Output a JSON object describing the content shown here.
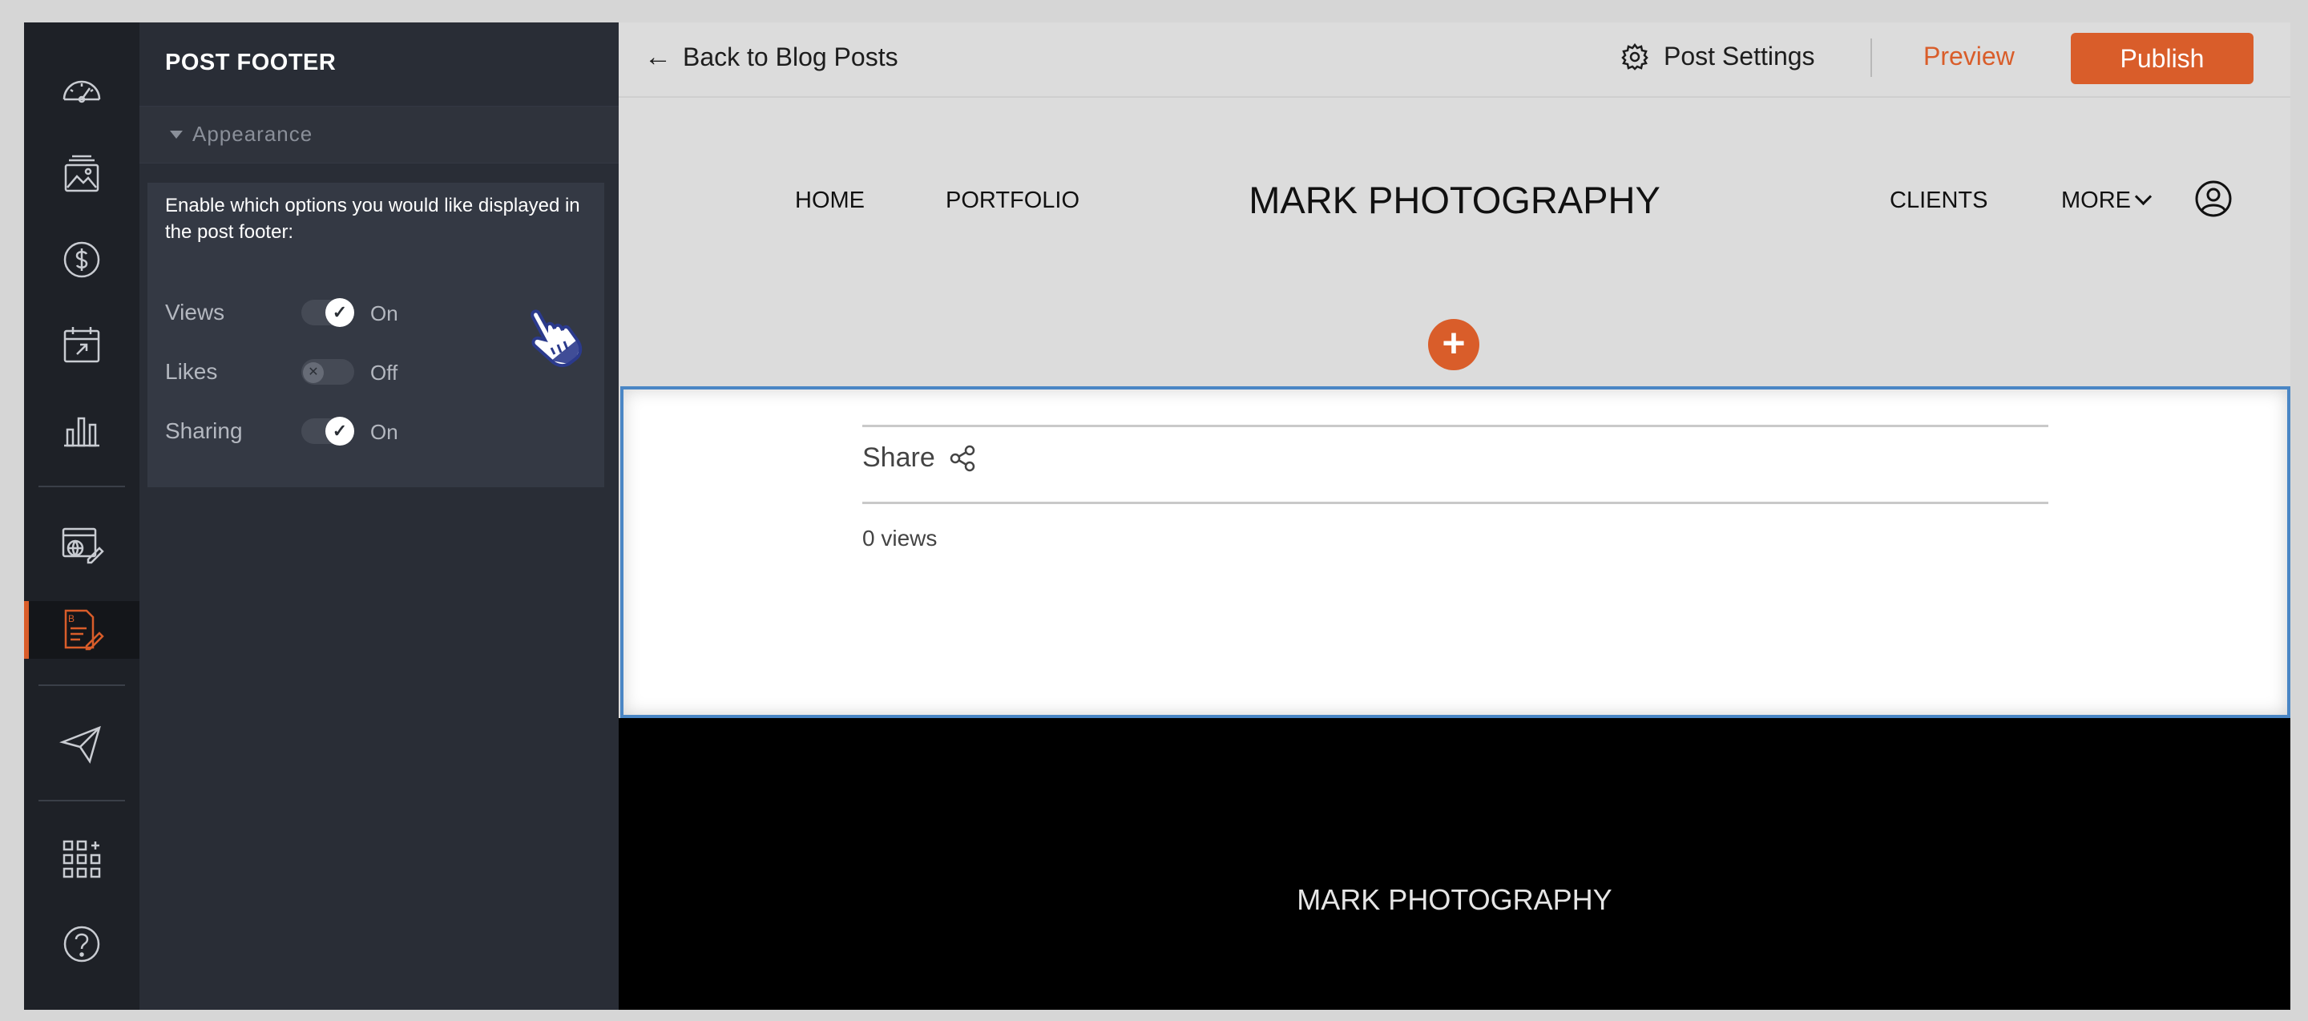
{
  "rail": {
    "icons": [
      "dashboard-icon",
      "gallery-icon",
      "dollar-icon",
      "calendar-icon",
      "analytics-icon",
      "website-editor-icon",
      "blog-editor-icon",
      "send-icon",
      "apps-icon",
      "help-icon"
    ],
    "active": "blog-editor-icon",
    "accent": "#d95d2a"
  },
  "panel": {
    "title": "POST FOOTER",
    "section": "Appearance",
    "description": "Enable which options you would like displayed in the post footer:",
    "options": [
      {
        "label": "Views",
        "state": "On",
        "enabled": true
      },
      {
        "label": "Likes",
        "state": "Off",
        "enabled": false
      },
      {
        "label": "Sharing",
        "state": "On",
        "enabled": true
      }
    ]
  },
  "topbar": {
    "back_label": "Back to Blog Posts",
    "settings_label": "Post Settings",
    "preview_label": "Preview",
    "publish_label": "Publish"
  },
  "site": {
    "nav_left": [
      "HOME",
      "PORTFOLIO"
    ],
    "brand": "MARK PHOTOGRAPHY",
    "nav_right": [
      "CLIENTS",
      "MORE"
    ],
    "footer_brand": "MARK PHOTOGRAPHY"
  },
  "post_footer": {
    "share_label": "Share",
    "views_text": "0 views"
  }
}
